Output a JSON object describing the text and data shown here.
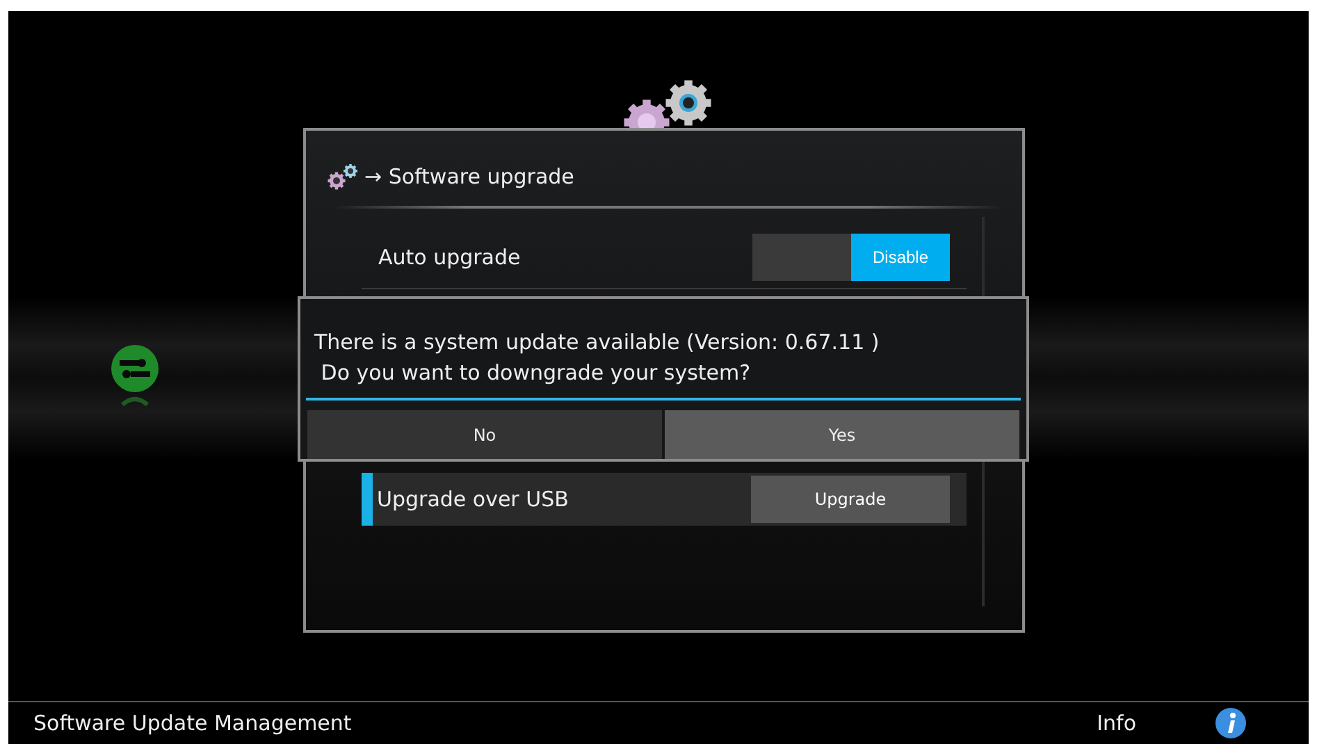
{
  "header": {
    "title": "→ Software upgrade"
  },
  "settings": [
    {
      "kind": "toggle",
      "label": "Auto upgrade",
      "value": "Disable",
      "selected": false
    },
    {
      "kind": "button",
      "label": "Upgrade over USB",
      "button": "Upgrade",
      "selected": true
    }
  ],
  "dialog": {
    "message_lines": [
      "There is a system update available (Version: 0.67.11 )",
      " Do you want to downgrade your system?"
    ],
    "buttons": [
      {
        "label": "No",
        "selected": false
      },
      {
        "label": "Yes",
        "selected": true
      }
    ]
  },
  "status_bar": {
    "title": "Software Update Management",
    "info": "Info"
  }
}
